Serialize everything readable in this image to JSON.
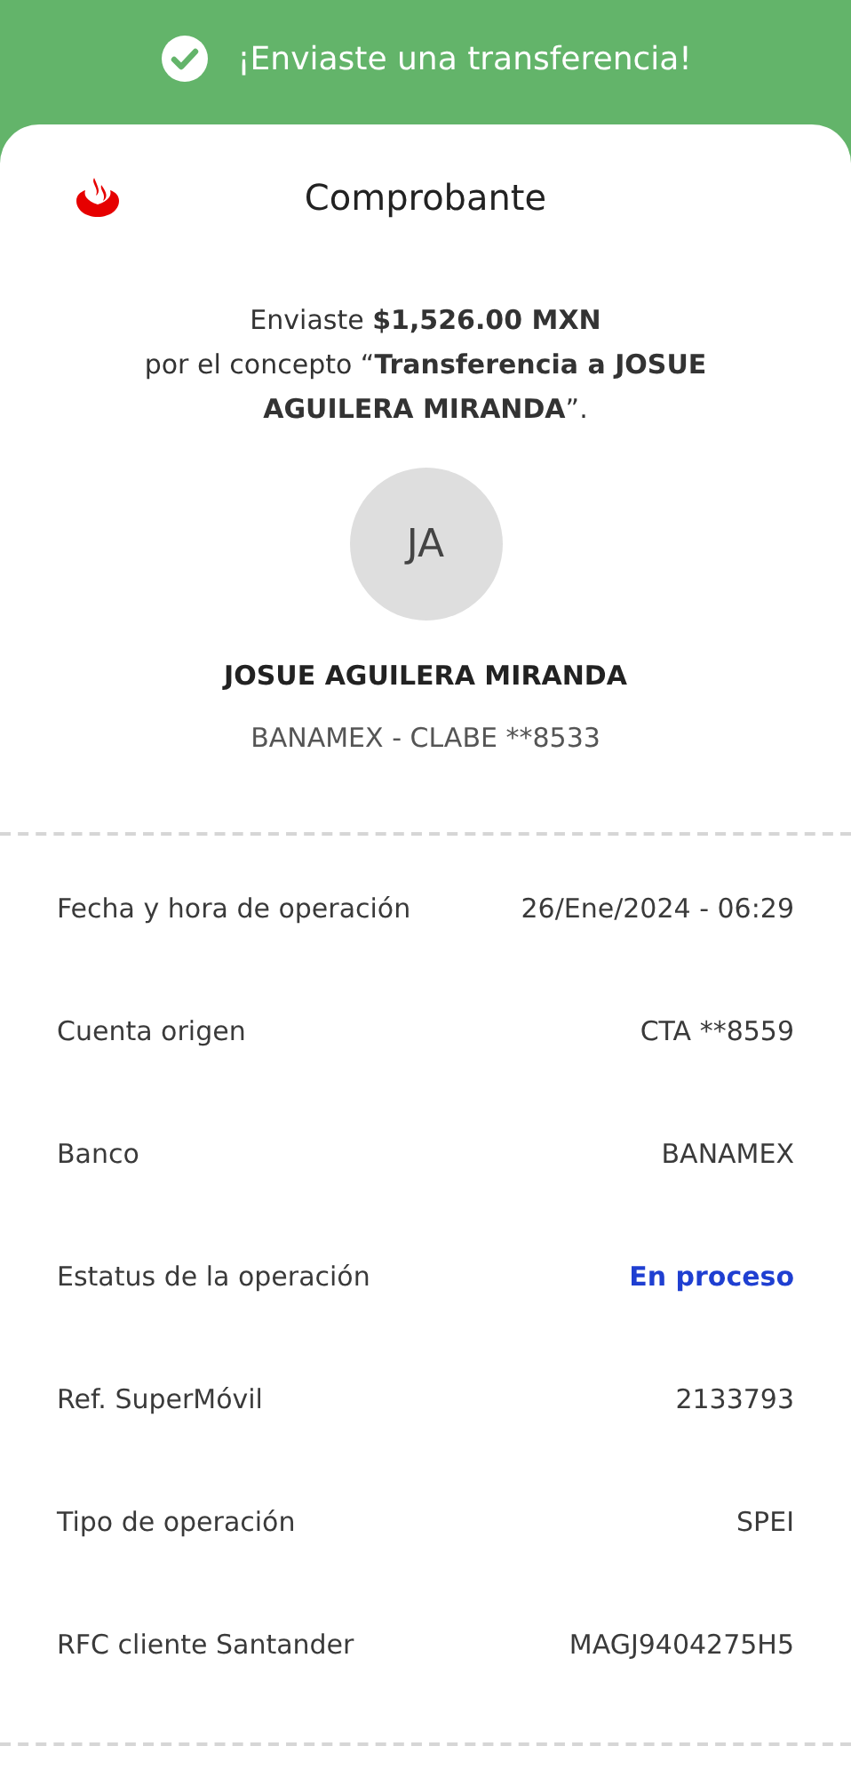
{
  "banner": {
    "title": "¡Enviaste una transferencia!"
  },
  "header": {
    "title": "Comprobante"
  },
  "summary": "Enviaste **$1,526.00 MXN**\npor el concepto “**Transferencia a JOSUE AGUILERA MIRANDA**”.",
  "recipient": {
    "initials": "JA",
    "name": "JOSUE AGUILERA MIRANDA",
    "account": "BANAMEX - CLABE **8533"
  },
  "details": [
    {
      "label": "Fecha y hora de operación",
      "value": "26/Ene/2024 - 06:29",
      "kind": "plain"
    },
    {
      "label": "Cuenta origen",
      "value": "CTA **8559",
      "kind": "plain"
    },
    {
      "label": "Banco",
      "value": "BANAMEX",
      "kind": "plain"
    },
    {
      "label": "Estatus de la operación",
      "value": "En proceso",
      "kind": "status"
    },
    {
      "label": "Ref. SuperMóvil",
      "value": "2133793",
      "kind": "plain"
    },
    {
      "label": "Tipo de operación",
      "value": "SPEI",
      "kind": "plain"
    },
    {
      "label": "RFC cliente Santander",
      "value": "MAGJ9404275H5",
      "kind": "plain"
    }
  ]
}
